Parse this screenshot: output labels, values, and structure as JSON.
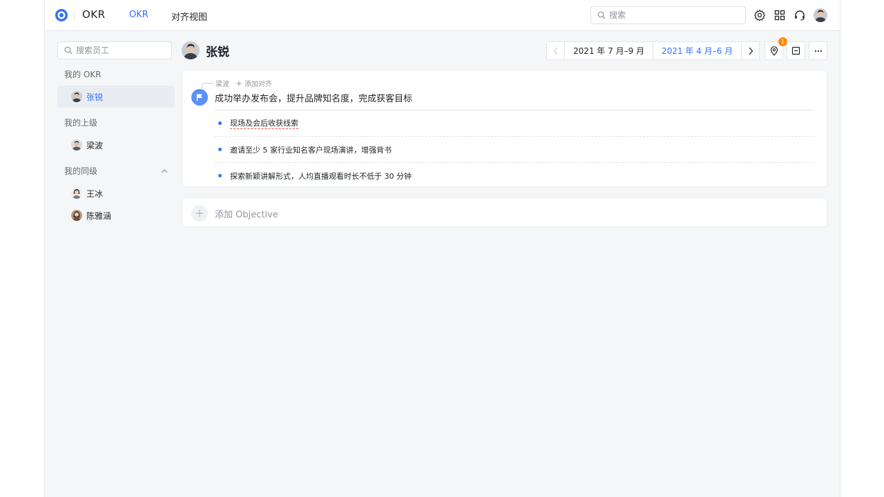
{
  "header": {
    "app_name": "OKR",
    "tabs": [
      {
        "label": "OKR",
        "active": true
      },
      {
        "label": "对齐视图",
        "active": false
      }
    ],
    "search_placeholder": "搜索",
    "icons": [
      "settings-icon",
      "apps-grid-icon",
      "headset-icon",
      "user-avatar"
    ]
  },
  "sidebar": {
    "search_placeholder": "搜索员工",
    "my_okr": {
      "title": "我的 OKR",
      "people": [
        {
          "name": "张锐",
          "active": true
        }
      ]
    },
    "superiors": {
      "title": "我的上级",
      "people": [
        {
          "name": "梁波"
        }
      ]
    },
    "peers": {
      "title": "我的同级",
      "people": [
        {
          "name": "王冰"
        },
        {
          "name": "陈雅涵"
        }
      ]
    }
  },
  "main": {
    "user_name": "张锐",
    "periods": [
      {
        "label": "2021 年 7 月–9 月",
        "active": false
      },
      {
        "label": "2021 年 4 月–6 月",
        "active": true
      }
    ],
    "notification_count": "1",
    "objective": {
      "aligned_to": "梁波",
      "add_alignment": "添加对齐",
      "title": "成功举办发布会，提升品牌知名度，完成获客目标",
      "key_results": [
        {
          "text": "现场及会后收获线索"
        },
        {
          "text": "邀请至少 5 家行业知名客户现场演讲，增强背书"
        },
        {
          "text": "探索新颖讲解形式，人均直播观看时长不低于 30 分钟"
        }
      ]
    },
    "add_objective_label": "添加 Objective"
  },
  "colors": {
    "accent": "#3370ff",
    "badge": "#ff8800",
    "flag": "#5b8ff9"
  }
}
